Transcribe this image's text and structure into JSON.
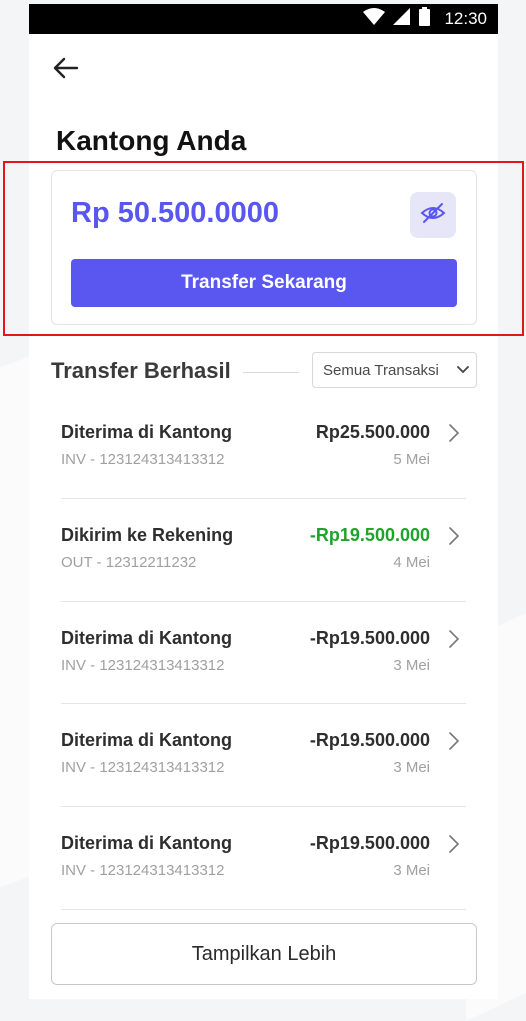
{
  "status_bar": {
    "time": "12:30"
  },
  "header": {
    "title": "Kantong Anda"
  },
  "wallet": {
    "balance": "Rp 50.500.0000",
    "transfer_button_label": "Transfer Sekarang",
    "visibility_icon": "eye-off-icon",
    "accent_color": "#5a57f0"
  },
  "transactions_section": {
    "title": "Transfer Berhasil",
    "filter_selected": "Semua Transaksi",
    "items": [
      {
        "title": "Diterima di Kantong",
        "ref": "INV - 123124313413312",
        "amount": "Rp25.500.000",
        "date": "5 Mei",
        "amount_color": "#2e2e2e"
      },
      {
        "title": "Dikirim ke Rekening",
        "ref": "OUT - 12312211232",
        "amount": "-Rp19.500.000",
        "date": "4 Mei",
        "amount_color": "#1fa32b"
      },
      {
        "title": "Diterima di Kantong",
        "ref": "INV - 123124313413312",
        "amount": "-Rp19.500.000",
        "date": "3 Mei",
        "amount_color": "#2e2e2e"
      },
      {
        "title": "Diterima di Kantong",
        "ref": "INV - 123124313413312",
        "amount": "-Rp19.500.000",
        "date": "3 Mei",
        "amount_color": "#2e2e2e"
      },
      {
        "title": "Diterima di Kantong",
        "ref": "INV - 123124313413312",
        "amount": "-Rp19.500.000",
        "date": "3 Mei",
        "amount_color": "#2e2e2e"
      }
    ]
  },
  "footer": {
    "more_button_label": "Tampilkan Lebih"
  },
  "colors": {
    "highlight": "#e3161b",
    "success": "#1fa32b"
  }
}
